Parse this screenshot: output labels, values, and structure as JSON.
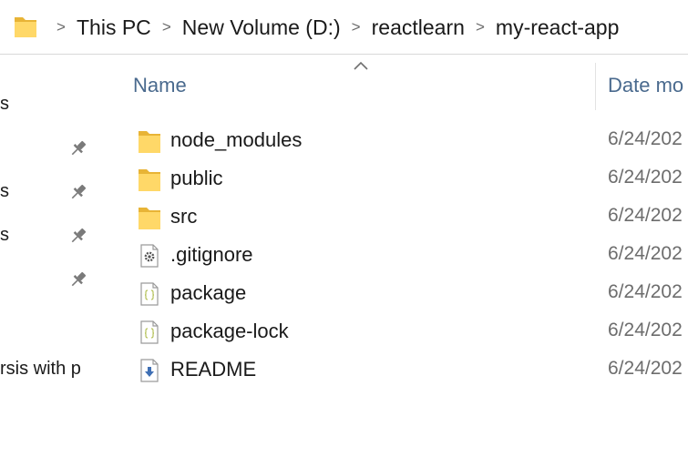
{
  "address_bar": {
    "crumbs": [
      "This PC",
      "New Volume (D:)",
      "reactlearn",
      "my-react-app"
    ],
    "separator": ">"
  },
  "nav_pane": {
    "items": [
      {
        "label": "s",
        "pinned": false
      },
      {
        "label": "",
        "pinned": true
      },
      {
        "label": "s",
        "pinned": true
      },
      {
        "label": "s",
        "pinned": true
      },
      {
        "label": "",
        "pinned": true
      },
      {
        "label": "rsis with p",
        "pinned": false
      }
    ]
  },
  "file_list": {
    "sort_indicator": "ascending",
    "columns": {
      "name": "Name",
      "date_modified": "Date mo"
    },
    "rows": [
      {
        "name": "node_modules",
        "icon": "folder-icon",
        "date": "6/24/202"
      },
      {
        "name": "public",
        "icon": "folder-icon",
        "date": "6/24/202"
      },
      {
        "name": "src",
        "icon": "folder-icon",
        "date": "6/24/202"
      },
      {
        "name": ".gitignore",
        "icon": "settings-file-icon",
        "date": "6/24/202"
      },
      {
        "name": "package",
        "icon": "json-file-icon",
        "date": "6/24/202"
      },
      {
        "name": "package-lock",
        "icon": "json-file-icon",
        "date": "6/24/202"
      },
      {
        "name": "README",
        "icon": "markdown-file-icon",
        "date": "6/24/202"
      }
    ]
  },
  "colors": {
    "folder_yellow": "#ffd868",
    "folder_dark": "#e8b436",
    "header_text": "#4a6a8e",
    "date_text": "#6d6d6d",
    "border": "#d9d9d9"
  }
}
